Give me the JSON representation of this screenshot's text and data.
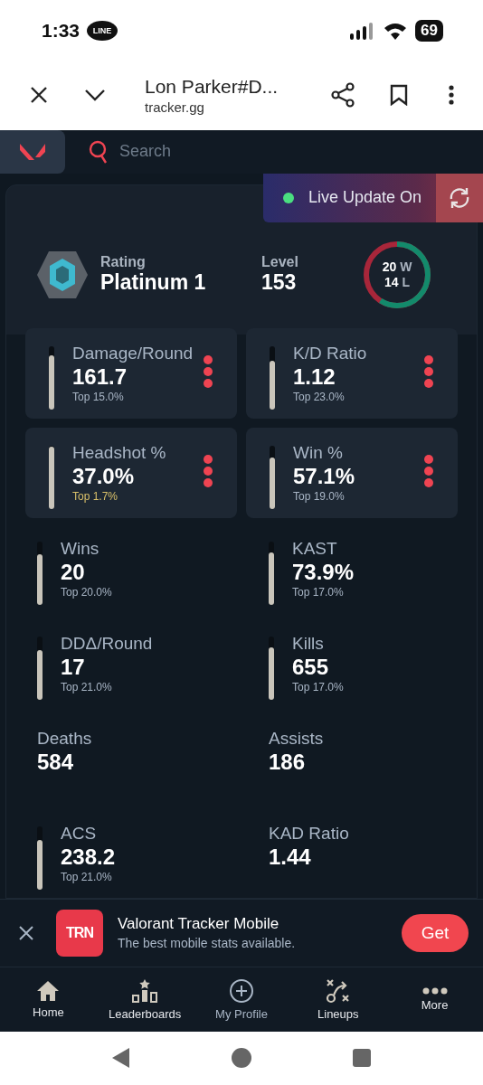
{
  "status_bar": {
    "time": "1:33",
    "notification": "LINE",
    "battery": "69"
  },
  "browser": {
    "title": "Lon Parker#D...",
    "url": "tracker.gg"
  },
  "app_header": {
    "search": {
      "placeholder": "Search"
    }
  },
  "live_update": {
    "label": "Live Update On",
    "on": true
  },
  "profile": {
    "rating_label": "Rating",
    "rating": "Platinum 1",
    "level_label": "Level",
    "level": "153",
    "record": {
      "wins": "20",
      "wins_label": "W",
      "losses": "14",
      "losses_label": "L",
      "level": 0.59
    }
  },
  "stats": [
    {
      "kind": "card",
      "label": "Damage/Round",
      "value": "161.7",
      "percentile": "Top 15.0%",
      "highlight": false,
      "level": 0.85
    },
    {
      "kind": "card",
      "label": "K/D Ratio",
      "value": "1.12",
      "percentile": "Top 23.0%",
      "highlight": false,
      "level": 0.77
    },
    {
      "kind": "card",
      "label": "Headshot %",
      "value": "37.0%",
      "percentile": "Top 1.7%",
      "highlight": true,
      "level": 0.98
    },
    {
      "kind": "card",
      "label": "Win %",
      "value": "57.1%",
      "percentile": "Top 19.0%",
      "highlight": false,
      "level": 0.81
    },
    {
      "kind": "bar",
      "label": "Wins",
      "value": "20",
      "percentile": "Top 20.0%",
      "level": 0.8
    },
    {
      "kind": "bar",
      "label": "KAST",
      "value": "73.9%",
      "percentile": "Top 17.0%",
      "level": 0.83
    },
    {
      "kind": "bar",
      "label": "DDΔ/Round",
      "value": "17",
      "percentile": "Top 21.0%",
      "level": 0.79
    },
    {
      "kind": "bar",
      "label": "Kills",
      "value": "655",
      "percentile": "Top 17.0%",
      "level": 0.83
    },
    {
      "kind": "plain",
      "label": "Deaths",
      "value": "584"
    },
    {
      "kind": "plain",
      "label": "Assists",
      "value": "186"
    },
    {
      "kind": "bar",
      "label": "ACS",
      "value": "238.2",
      "percentile": "Top 21.0%",
      "level": 0.79
    },
    {
      "kind": "plain",
      "label": "KAD Ratio",
      "value": "1.44"
    }
  ],
  "app_banner": {
    "logo": "TRN",
    "title": "Valorant Tracker Mobile",
    "subtitle": "The best mobile stats available.",
    "button": "Get"
  },
  "bottom_nav": [
    {
      "label": "Home",
      "selected": false
    },
    {
      "label": "Leaderboards",
      "selected": false
    },
    {
      "label": "My Profile",
      "selected": true
    },
    {
      "label": "Lineups",
      "selected": false
    },
    {
      "label": "More",
      "selected": false
    }
  ]
}
